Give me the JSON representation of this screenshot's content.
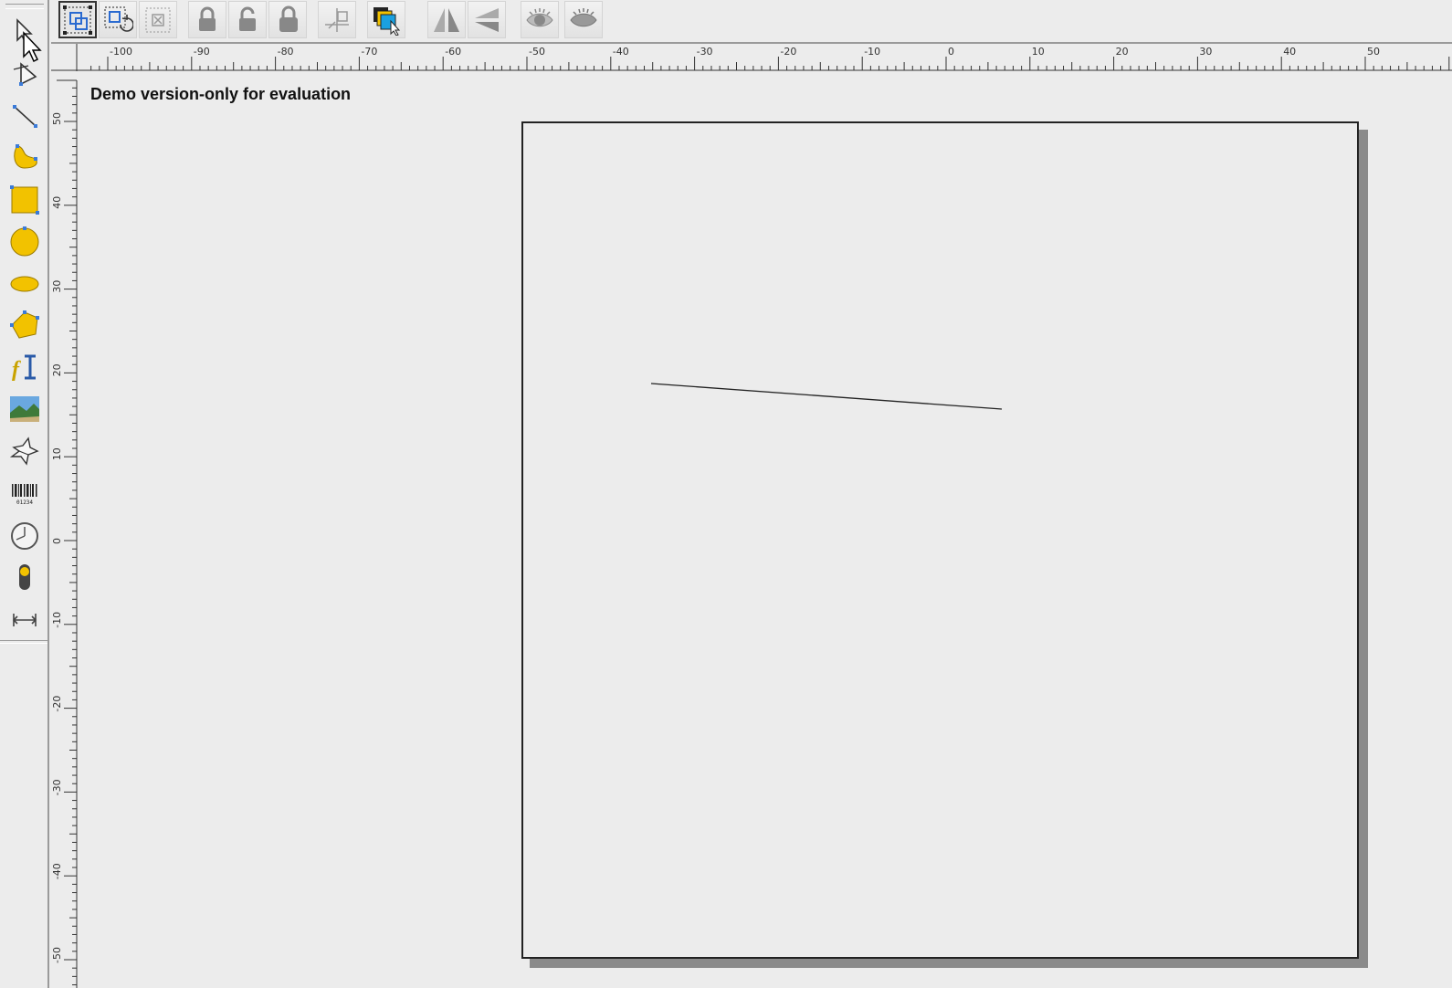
{
  "canvas": {
    "notice": "Demo version-only for evaluation"
  },
  "toolbar": {
    "buttons": [
      {
        "name": "group-select-icon"
      },
      {
        "name": "rotate-select-icon"
      },
      {
        "name": "ungroup-icon"
      },
      {
        "name": "lock-icon"
      },
      {
        "name": "unlock-icon"
      },
      {
        "name": "lock-all-icon"
      },
      {
        "name": "align-icon"
      },
      {
        "name": "layers-icon"
      },
      {
        "name": "flip-horizontal-icon"
      },
      {
        "name": "flip-vertical-icon"
      },
      {
        "name": "show-icon"
      },
      {
        "name": "hide-icon"
      }
    ]
  },
  "toolbox": {
    "tools": [
      "select-tool-icon",
      "node-edit-tool-icon",
      "line-tool-icon",
      "curve-tool-icon",
      "rectangle-tool-icon",
      "circle-tool-icon",
      "ellipse-tool-icon",
      "polygon-tool-icon",
      "text-tool-icon",
      "image-tool-icon",
      "star-tool-icon",
      "barcode-tool-icon",
      "clock-tool-icon",
      "switch-tool-icon",
      "dimension-tool-icon"
    ],
    "barcode_digits": "01234"
  },
  "ruler": {
    "horizontal_labels": [
      "-100",
      "-90",
      "-80",
      "-70",
      "-60",
      "-50",
      "-40",
      "-30",
      "-20",
      "-10",
      "0",
      "10",
      "20",
      "30",
      "40",
      "50"
    ],
    "vertical_labels": [
      "50",
      "40",
      "30",
      "20",
      "10",
      "0",
      "-10",
      "-20",
      "-30",
      "-40",
      "-50"
    ]
  },
  "colors": {
    "accent_yellow": "#f2c200",
    "background": "#ececec",
    "page_border": "#222222",
    "shadow": "#8a8a8a"
  }
}
